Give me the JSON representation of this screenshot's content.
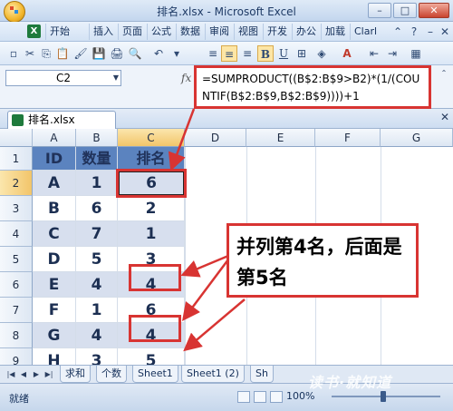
{
  "window": {
    "title": "排名.xlsx - Microsoft Excel",
    "controls": [
      "–",
      "□",
      "✕"
    ]
  },
  "ribbon": {
    "tabs": [
      "开始",
      "插入",
      "页面",
      "公式",
      "数据",
      "审阅",
      "视图",
      "开发",
      "办公",
      "加载",
      "Clarl"
    ]
  },
  "toolbar": {
    "buttons": [
      "✂",
      "⎘",
      "🖌",
      "💾",
      "🖨",
      "↶",
      "B",
      "U",
      "A"
    ]
  },
  "formula_bar": {
    "name_box": "C2",
    "fx": "fx",
    "formula": "=SUMPRODUCT((B$2:B$9>B2)*(1/(COUNTIF(B$2:B$9,B$2:B$9))))+1"
  },
  "workbook": {
    "tab": "排名.xlsx"
  },
  "grid": {
    "columns": [
      "A",
      "B",
      "C",
      "D",
      "E",
      "F",
      "G"
    ],
    "rows": [
      "1",
      "2",
      "3",
      "4",
      "5",
      "6",
      "7",
      "8",
      "9"
    ],
    "header": [
      "ID",
      "数量",
      "排名"
    ],
    "data": [
      [
        "A",
        "1",
        "6"
      ],
      [
        "B",
        "6",
        "2"
      ],
      [
        "C",
        "7",
        "1"
      ],
      [
        "D",
        "5",
        "3"
      ],
      [
        "E",
        "4",
        "4"
      ],
      [
        "F",
        "1",
        "6"
      ],
      [
        "G",
        "4",
        "4"
      ],
      [
        "H",
        "3",
        "5"
      ]
    ]
  },
  "annotation": {
    "callout": "并列第4名，后面是第5名"
  },
  "sheets": [
    "求和",
    "个数",
    "Sheet1",
    "Sheet1 (2)",
    "Sh"
  ],
  "status": {
    "text": "就绪",
    "zoom": "100%"
  },
  "watermark": "读书·就知道",
  "colors": {
    "header_fill": "#5b83bf",
    "band_fill": "#d7dfee",
    "annotation": "#d83432"
  }
}
